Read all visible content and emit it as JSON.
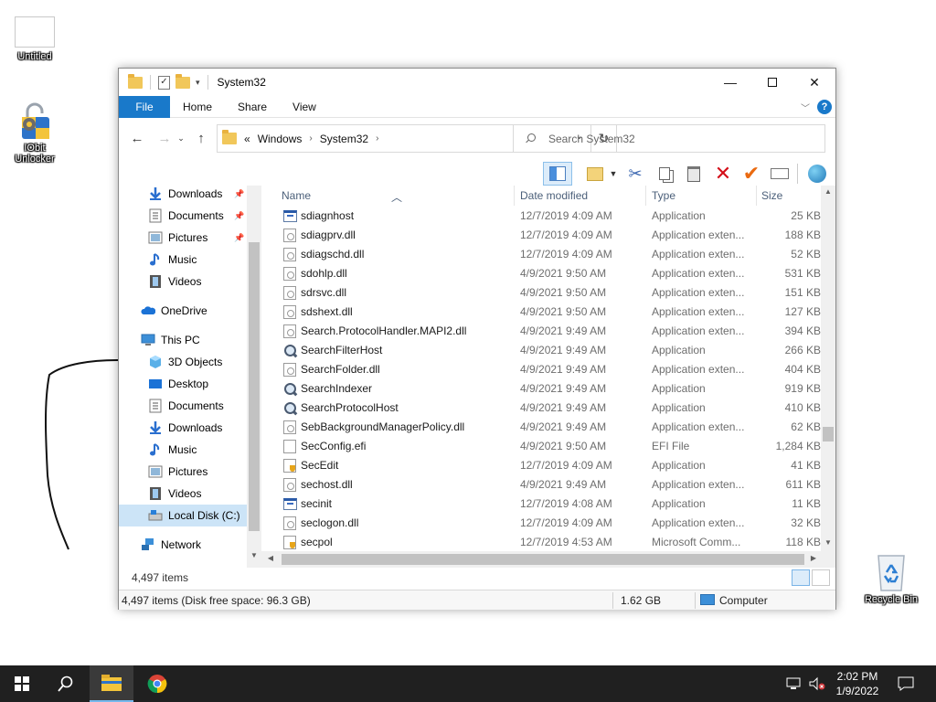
{
  "desktop": {
    "icons": [
      {
        "label": "Untitled"
      },
      {
        "label": "IObit Unlocker"
      },
      {
        "label": "Recycle Bin"
      }
    ]
  },
  "window": {
    "title": "System32",
    "ribbon_tabs": [
      "File",
      "Home",
      "Share",
      "View"
    ],
    "address": {
      "overflow": "«",
      "crumbs": [
        "Windows",
        "System32"
      ]
    },
    "search_placeholder": "Search System32"
  },
  "nav": [
    {
      "label": "Downloads",
      "icon": "download-arrow-icon",
      "pinned": true
    },
    {
      "label": "Documents",
      "icon": "document-icon",
      "pinned": true
    },
    {
      "label": "Pictures",
      "icon": "picture-icon",
      "pinned": true
    },
    {
      "label": "Music",
      "icon": "music-note-icon",
      "pinned": false
    },
    {
      "label": "Videos",
      "icon": "film-icon",
      "pinned": false
    },
    {
      "label": "OneDrive",
      "icon": "cloud-icon",
      "pinned": false
    },
    {
      "label": "This PC",
      "icon": "computer-icon",
      "pinned": false
    },
    {
      "label": "3D Objects",
      "icon": "cube-icon",
      "pinned": false
    },
    {
      "label": "Desktop",
      "icon": "desktop-icon",
      "pinned": false
    },
    {
      "label": "Documents",
      "icon": "document-icon",
      "pinned": false
    },
    {
      "label": "Downloads",
      "icon": "download-arrow-icon",
      "pinned": false
    },
    {
      "label": "Music",
      "icon": "music-note-icon",
      "pinned": false
    },
    {
      "label": "Pictures",
      "icon": "picture-icon",
      "pinned": false
    },
    {
      "label": "Videos",
      "icon": "film-icon",
      "pinned": false
    },
    {
      "label": "Local Disk (C:)",
      "icon": "drive-icon",
      "pinned": false,
      "selected": true
    },
    {
      "label": "Network",
      "icon": "network-icon",
      "pinned": false
    }
  ],
  "columns": {
    "name": "Name",
    "date": "Date modified",
    "type": "Type",
    "size": "Size"
  },
  "files": [
    {
      "name": "sdiagnhost",
      "date": "12/7/2019 4:09 AM",
      "type": "Application",
      "size": "25 KB",
      "icon": "app"
    },
    {
      "name": "sdiagprv.dll",
      "date": "12/7/2019 4:09 AM",
      "type": "Application exten...",
      "size": "188 KB",
      "icon": "dll"
    },
    {
      "name": "sdiagschd.dll",
      "date": "12/7/2019 4:09 AM",
      "type": "Application exten...",
      "size": "52 KB",
      "icon": "dll"
    },
    {
      "name": "sdohlp.dll",
      "date": "4/9/2021 9:50 AM",
      "type": "Application exten...",
      "size": "531 KB",
      "icon": "dll"
    },
    {
      "name": "sdrsvc.dll",
      "date": "4/9/2021 9:50 AM",
      "type": "Application exten...",
      "size": "151 KB",
      "icon": "dll"
    },
    {
      "name": "sdshext.dll",
      "date": "4/9/2021 9:50 AM",
      "type": "Application exten...",
      "size": "127 KB",
      "icon": "dll"
    },
    {
      "name": "Search.ProtocolHandler.MAPI2.dll",
      "date": "4/9/2021 9:49 AM",
      "type": "Application exten...",
      "size": "394 KB",
      "icon": "dll"
    },
    {
      "name": "SearchFilterHost",
      "date": "4/9/2021 9:49 AM",
      "type": "Application",
      "size": "266 KB",
      "icon": "search"
    },
    {
      "name": "SearchFolder.dll",
      "date": "4/9/2021 9:49 AM",
      "type": "Application exten...",
      "size": "404 KB",
      "icon": "dll"
    },
    {
      "name": "SearchIndexer",
      "date": "4/9/2021 9:49 AM",
      "type": "Application",
      "size": "919 KB",
      "icon": "search"
    },
    {
      "name": "SearchProtocolHost",
      "date": "4/9/2021 9:49 AM",
      "type": "Application",
      "size": "410 KB",
      "icon": "search"
    },
    {
      "name": "SebBackgroundManagerPolicy.dll",
      "date": "4/9/2021 9:49 AM",
      "type": "Application exten...",
      "size": "62 KB",
      "icon": "dll"
    },
    {
      "name": "SecConfig.efi",
      "date": "4/9/2021 9:50 AM",
      "type": "EFI File",
      "size": "1,284 KB",
      "icon": "efi"
    },
    {
      "name": "SecEdit",
      "date": "12/7/2019 4:09 AM",
      "type": "Application",
      "size": "41 KB",
      "icon": "shield"
    },
    {
      "name": "sechost.dll",
      "date": "4/9/2021 9:49 AM",
      "type": "Application exten...",
      "size": "611 KB",
      "icon": "dll"
    },
    {
      "name": "secinit",
      "date": "12/7/2019 4:08 AM",
      "type": "Application",
      "size": "11 KB",
      "icon": "app"
    },
    {
      "name": "seclogon.dll",
      "date": "12/7/2019 4:09 AM",
      "type": "Application exten...",
      "size": "32 KB",
      "icon": "dll"
    },
    {
      "name": "secpol",
      "date": "12/7/2019 4:53 AM",
      "type": "Microsoft Comm...",
      "size": "118 KB",
      "icon": "shield"
    }
  ],
  "status": {
    "item_count": "4,497 items",
    "details": "4,497 items (Disk free space: 96.3 GB)",
    "size": "1.62 GB",
    "location": "Computer"
  },
  "taskbar": {
    "time": "2:02 PM",
    "date": "1/9/2022"
  },
  "colors": {
    "accent": "#1979ca",
    "taskbar": "#202020",
    "selected_nav": "#cce4f7"
  }
}
